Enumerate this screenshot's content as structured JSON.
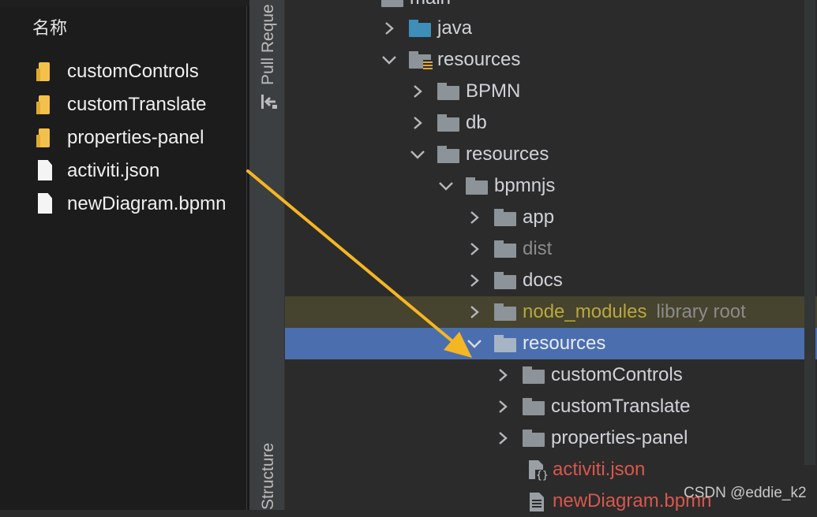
{
  "explorer": {
    "column_header": "名称",
    "items": [
      {
        "name": "customControls",
        "kind": "folder"
      },
      {
        "name": "customTranslate",
        "kind": "folder"
      },
      {
        "name": "properties-panel",
        "kind": "folder"
      },
      {
        "name": "activiti.json",
        "kind": "file"
      },
      {
        "name": "newDiagram.bpmn",
        "kind": "file"
      }
    ]
  },
  "toolstrip": {
    "pull_requests_label": "Pull Reque",
    "structure_label": "Structure"
  },
  "tree": {
    "rows": [
      {
        "label": "main"
      },
      {
        "label": "java"
      },
      {
        "label": "resources"
      },
      {
        "label": "BPMN"
      },
      {
        "label": "db"
      },
      {
        "label": "resources"
      },
      {
        "label": "bpmnjs"
      },
      {
        "label": "app"
      },
      {
        "label": "dist"
      },
      {
        "label": "docs"
      },
      {
        "label": "node_modules",
        "suffix": "library root"
      },
      {
        "label": "resources"
      },
      {
        "label": "customControls"
      },
      {
        "label": "customTranslate"
      },
      {
        "label": "properties-panel"
      },
      {
        "label": "activiti.json"
      },
      {
        "label": "newDiagram.bpmn"
      }
    ]
  },
  "colors": {
    "selection": "#4b6eaf",
    "library_row": "#46432f",
    "arrow": "#f5b623",
    "modified_file": "#d8574d",
    "library_name": "#b9a83c"
  },
  "watermark": "CSDN @eddie_k2"
}
